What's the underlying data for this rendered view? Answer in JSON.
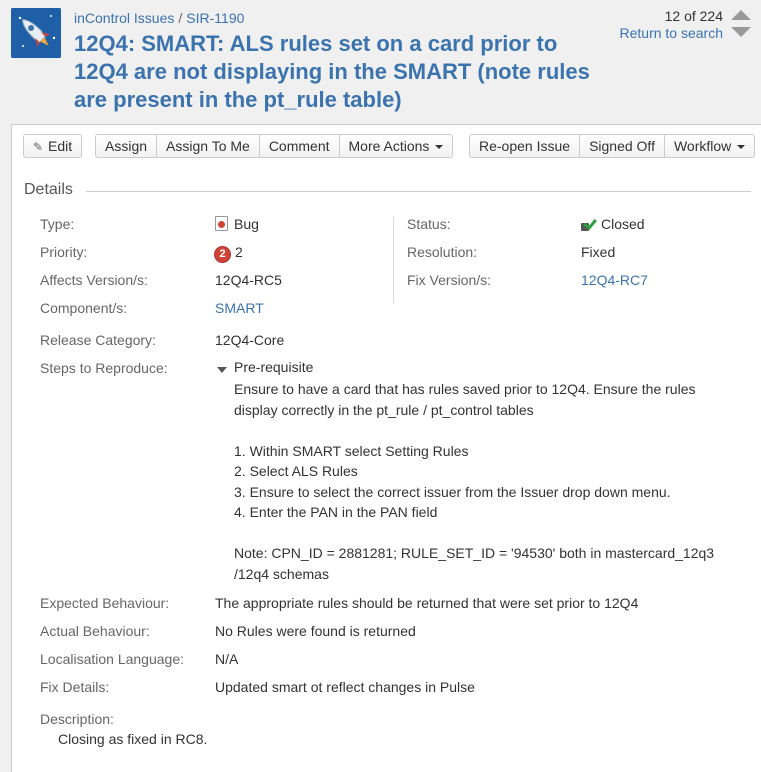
{
  "header": {
    "project_link": "inControl Issues",
    "separator": "/",
    "issue_key": "SIR-1190",
    "title": "12Q4: SMART: ALS rules set on a card prior to 12Q4 are not displaying in the SMART (note rules are present in the pt_rule table)",
    "pager_count": "12 of 224",
    "return_link": "Return to search"
  },
  "toolbar": {
    "edit": "Edit",
    "assign": "Assign",
    "assign_to_me": "Assign To Me",
    "comment": "Comment",
    "more_actions": "More Actions",
    "reopen": "Re-open Issue",
    "signed_off": "Signed Off",
    "workflow": "Workflow"
  },
  "details": {
    "heading": "Details",
    "type_label": "Type:",
    "type_value": "Bug",
    "priority_label": "Priority:",
    "priority_value": "2",
    "priority_badge": "2",
    "affects_label": "Affects Version/s:",
    "affects_value": "12Q4-RC5",
    "component_label": "Component/s:",
    "component_value": "SMART",
    "status_label": "Status:",
    "status_value": "Closed",
    "resolution_label": "Resolution:",
    "resolution_value": "Fixed",
    "fix_version_label": "Fix Version/s:",
    "fix_version_value": "12Q4-RC7",
    "release_label": "Release Category:",
    "release_value": "12Q4-Core",
    "steps_label": "Steps to Reproduce:",
    "steps_title": "Pre-requisite",
    "steps_lines": [
      "Ensure to have a card that has rules saved prior to 12Q4. Ensure the rules display correctly in the pt_rule / pt_control tables",
      "1. Within SMART select Setting Rules",
      "2. Select ALS Rules",
      "3. Ensure to select the correct issuer from the Issuer drop down menu.",
      "4. Enter the PAN in the PAN field",
      "Note: CPN_ID = 2881281; RULE_SET_ID = '94530' both in mastercard_12q3 /12q4 schemas"
    ],
    "expected_label": "Expected Behaviour:",
    "expected_value": "The appropriate rules should be returned that were set prior to 12Q4",
    "actual_label": "Actual Behaviour:",
    "actual_value": "No Rules were found is returned",
    "localisation_label": "Localisation Language:",
    "localisation_value": "N/A",
    "fix_details_label": "Fix Details:",
    "fix_details_value": "Updated smart ot reflect changes in Pulse",
    "description_label": "Description:",
    "description_value": "Closing as fixed in RC8."
  },
  "colors": {
    "link": "#3b73af",
    "priority_red": "#d04437",
    "closed_green": "#2e9e3e",
    "avatar_blue": "#1f5fa8"
  },
  "icons": [
    "project-avatar-rocket-icon",
    "pencil-icon",
    "bug-icon",
    "priority-icon",
    "closed-status-icon",
    "collapse-triangle-icon",
    "previous-arrow-icon",
    "next-arrow-icon"
  ]
}
